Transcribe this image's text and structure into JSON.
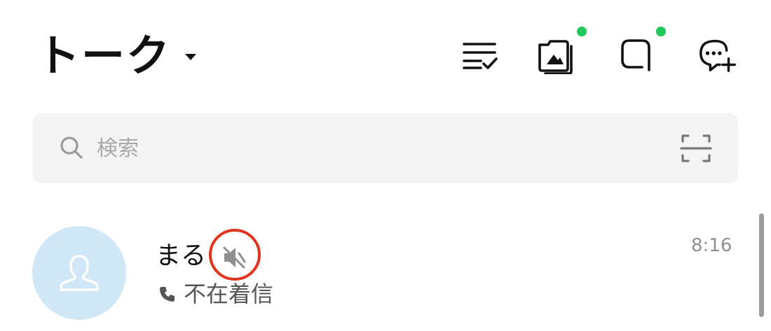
{
  "header": {
    "title": "トーク",
    "actions": [
      {
        "icon": "edit-list-icon",
        "badge": false
      },
      {
        "icon": "album-icon",
        "badge": true
      },
      {
        "icon": "openchat-icon",
        "badge": true
      },
      {
        "icon": "new-chat-icon",
        "badge": false
      }
    ],
    "badge_color": "#1ec85a"
  },
  "search": {
    "placeholder": "検索",
    "search_icon": "search-icon",
    "scan_icon": "scan-qr-icon"
  },
  "chats": [
    {
      "name": "まる",
      "muted": true,
      "preview_icon": "phone-icon",
      "preview": "不在着信",
      "time": "8:16",
      "avatar_icon": "person-icon",
      "avatar_color": "#cfe7f7"
    }
  ],
  "colors": {
    "highlight_ring": "#e2341d",
    "search_bg": "#f3f3f3",
    "muted_gray": "#8f8f8f"
  }
}
